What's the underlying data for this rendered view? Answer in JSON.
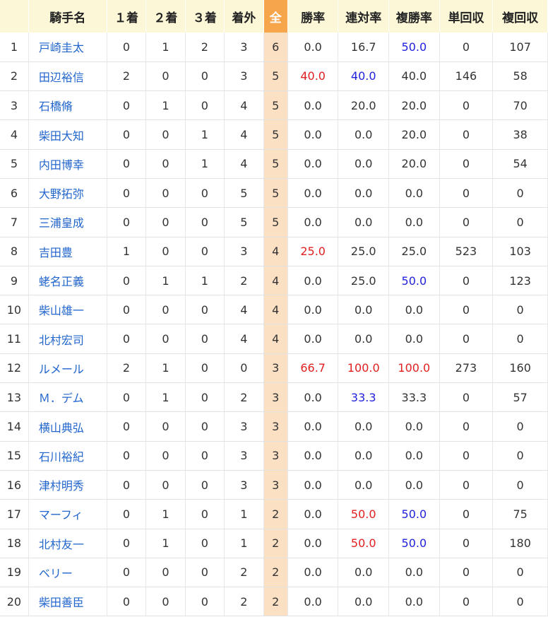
{
  "headers": [
    "",
    "騎手名",
    "１着",
    "２着",
    "３着",
    "着外",
    "全",
    "勝率",
    "連対率",
    "複勝率",
    "単回収",
    "複回収"
  ],
  "colors": {
    "red": "#e02020",
    "blue": "#2222dd",
    "link": "#2266cc",
    "all_header": "#f7a54a",
    "all_cell": "#fce0c4",
    "header_bg": "#fbf7d7"
  },
  "rows": [
    {
      "rank": "1",
      "name": "戸崎圭太",
      "w1": "0",
      "w2": "1",
      "w3": "2",
      "out": "3",
      "all": "6",
      "win": "0.0",
      "win_c": "",
      "ren": "16.7",
      "ren_c": "",
      "fuku": "50.0",
      "fuku_c": "blue",
      "tan": "0",
      "fret": "107"
    },
    {
      "rank": "2",
      "name": "田辺裕信",
      "w1": "2",
      "w2": "0",
      "w3": "0",
      "out": "3",
      "all": "5",
      "win": "40.0",
      "win_c": "red",
      "ren": "40.0",
      "ren_c": "blue",
      "fuku": "40.0",
      "fuku_c": "",
      "tan": "146",
      "fret": "58"
    },
    {
      "rank": "3",
      "name": "石橋脩",
      "w1": "0",
      "w2": "1",
      "w3": "0",
      "out": "4",
      "all": "5",
      "win": "0.0",
      "win_c": "",
      "ren": "20.0",
      "ren_c": "",
      "fuku": "20.0",
      "fuku_c": "",
      "tan": "0",
      "fret": "70"
    },
    {
      "rank": "4",
      "name": "柴田大知",
      "w1": "0",
      "w2": "0",
      "w3": "1",
      "out": "4",
      "all": "5",
      "win": "0.0",
      "win_c": "",
      "ren": "0.0",
      "ren_c": "",
      "fuku": "20.0",
      "fuku_c": "",
      "tan": "0",
      "fret": "38"
    },
    {
      "rank": "5",
      "name": "内田博幸",
      "w1": "0",
      "w2": "0",
      "w3": "1",
      "out": "4",
      "all": "5",
      "win": "0.0",
      "win_c": "",
      "ren": "0.0",
      "ren_c": "",
      "fuku": "20.0",
      "fuku_c": "",
      "tan": "0",
      "fret": "54"
    },
    {
      "rank": "6",
      "name": "大野拓弥",
      "w1": "0",
      "w2": "0",
      "w3": "0",
      "out": "5",
      "all": "5",
      "win": "0.0",
      "win_c": "",
      "ren": "0.0",
      "ren_c": "",
      "fuku": "0.0",
      "fuku_c": "",
      "tan": "0",
      "fret": "0"
    },
    {
      "rank": "7",
      "name": "三浦皇成",
      "w1": "0",
      "w2": "0",
      "w3": "0",
      "out": "5",
      "all": "5",
      "win": "0.0",
      "win_c": "",
      "ren": "0.0",
      "ren_c": "",
      "fuku": "0.0",
      "fuku_c": "",
      "tan": "0",
      "fret": "0"
    },
    {
      "rank": "8",
      "name": "吉田豊",
      "w1": "1",
      "w2": "0",
      "w3": "0",
      "out": "3",
      "all": "4",
      "win": "25.0",
      "win_c": "red",
      "ren": "25.0",
      "ren_c": "",
      "fuku": "25.0",
      "fuku_c": "",
      "tan": "523",
      "fret": "103"
    },
    {
      "rank": "9",
      "name": "蛯名正義",
      "w1": "0",
      "w2": "1",
      "w3": "1",
      "out": "2",
      "all": "4",
      "win": "0.0",
      "win_c": "",
      "ren": "25.0",
      "ren_c": "",
      "fuku": "50.0",
      "fuku_c": "blue",
      "tan": "0",
      "fret": "123"
    },
    {
      "rank": "10",
      "name": "柴山雄一",
      "w1": "0",
      "w2": "0",
      "w3": "0",
      "out": "4",
      "all": "4",
      "win": "0.0",
      "win_c": "",
      "ren": "0.0",
      "ren_c": "",
      "fuku": "0.0",
      "fuku_c": "",
      "tan": "0",
      "fret": "0"
    },
    {
      "rank": "11",
      "name": "北村宏司",
      "w1": "0",
      "w2": "0",
      "w3": "0",
      "out": "4",
      "all": "4",
      "win": "0.0",
      "win_c": "",
      "ren": "0.0",
      "ren_c": "",
      "fuku": "0.0",
      "fuku_c": "",
      "tan": "0",
      "fret": "0"
    },
    {
      "rank": "12",
      "name": "ルメール",
      "w1": "2",
      "w2": "1",
      "w3": "0",
      "out": "0",
      "all": "3",
      "win": "66.7",
      "win_c": "red",
      "ren": "100.0",
      "ren_c": "red",
      "fuku": "100.0",
      "fuku_c": "red",
      "tan": "273",
      "fret": "160"
    },
    {
      "rank": "13",
      "name": "Ｍ．デム",
      "w1": "0",
      "w2": "1",
      "w3": "0",
      "out": "2",
      "all": "3",
      "win": "0.0",
      "win_c": "",
      "ren": "33.3",
      "ren_c": "blue",
      "fuku": "33.3",
      "fuku_c": "",
      "tan": "0",
      "fret": "57"
    },
    {
      "rank": "14",
      "name": "横山典弘",
      "w1": "0",
      "w2": "0",
      "w3": "0",
      "out": "3",
      "all": "3",
      "win": "0.0",
      "win_c": "",
      "ren": "0.0",
      "ren_c": "",
      "fuku": "0.0",
      "fuku_c": "",
      "tan": "0",
      "fret": "0"
    },
    {
      "rank": "15",
      "name": "石川裕紀",
      "w1": "0",
      "w2": "0",
      "w3": "0",
      "out": "3",
      "all": "3",
      "win": "0.0",
      "win_c": "",
      "ren": "0.0",
      "ren_c": "",
      "fuku": "0.0",
      "fuku_c": "",
      "tan": "0",
      "fret": "0"
    },
    {
      "rank": "16",
      "name": "津村明秀",
      "w1": "0",
      "w2": "0",
      "w3": "0",
      "out": "3",
      "all": "3",
      "win": "0.0",
      "win_c": "",
      "ren": "0.0",
      "ren_c": "",
      "fuku": "0.0",
      "fuku_c": "",
      "tan": "0",
      "fret": "0"
    },
    {
      "rank": "17",
      "name": "マーフィ",
      "w1": "0",
      "w2": "1",
      "w3": "0",
      "out": "1",
      "all": "2",
      "win": "0.0",
      "win_c": "",
      "ren": "50.0",
      "ren_c": "red",
      "fuku": "50.0",
      "fuku_c": "blue",
      "tan": "0",
      "fret": "75"
    },
    {
      "rank": "18",
      "name": "北村友一",
      "w1": "0",
      "w2": "1",
      "w3": "0",
      "out": "1",
      "all": "2",
      "win": "0.0",
      "win_c": "",
      "ren": "50.0",
      "ren_c": "red",
      "fuku": "50.0",
      "fuku_c": "blue",
      "tan": "0",
      "fret": "180"
    },
    {
      "rank": "19",
      "name": "ベリー",
      "w1": "0",
      "w2": "0",
      "w3": "0",
      "out": "2",
      "all": "2",
      "win": "0.0",
      "win_c": "",
      "ren": "0.0",
      "ren_c": "",
      "fuku": "0.0",
      "fuku_c": "",
      "tan": "0",
      "fret": "0"
    },
    {
      "rank": "20",
      "name": "柴田善臣",
      "w1": "0",
      "w2": "0",
      "w3": "0",
      "out": "2",
      "all": "2",
      "win": "0.0",
      "win_c": "",
      "ren": "0.0",
      "ren_c": "",
      "fuku": "0.0",
      "fuku_c": "",
      "tan": "0",
      "fret": "0"
    }
  ]
}
